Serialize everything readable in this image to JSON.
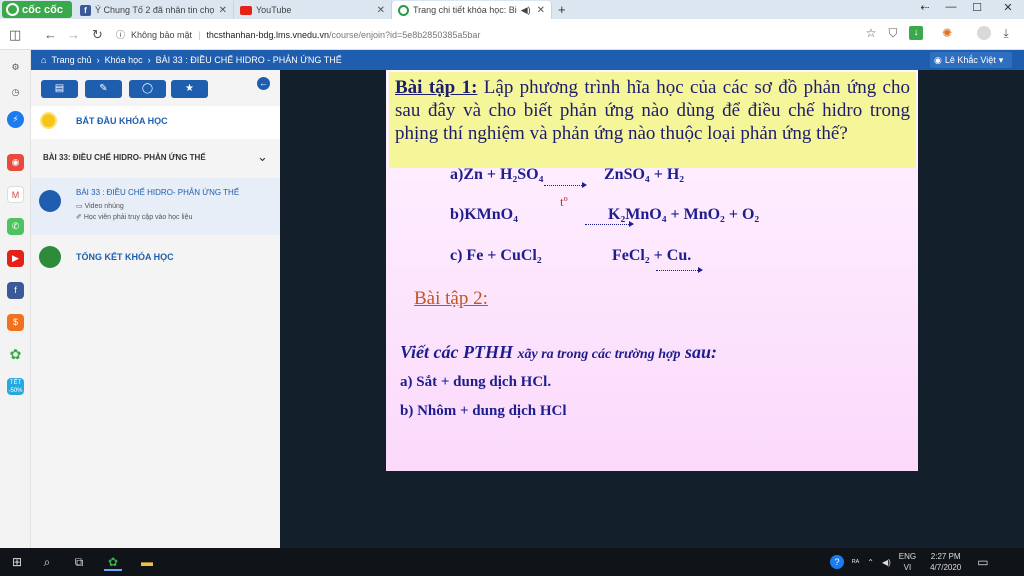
{
  "browser": {
    "brand": "cốc cốc",
    "tabs": [
      {
        "title": "Ý Chung Tố 2 đã nhân tin chọ",
        "icon": "facebook-icon"
      },
      {
        "title": "YouTube",
        "icon": "youtube-icon"
      },
      {
        "title": "Trang chi tiết khóa học: Bi",
        "icon": "coccoc-icon",
        "active": true
      }
    ],
    "new_tab": "+",
    "window_buttons": [
      "⇠",
      "—",
      "☐",
      "✕"
    ],
    "security_label": "Không bảo mật",
    "url_host": "thcsthanhan-bdg.lms.vnedu.vn",
    "url_path": "/course/enjoin?id=5e8b2850385a5bar"
  },
  "site_nav": {
    "home": "Trang chủ",
    "course": "Khóa học",
    "lesson": "BÀI 33 : ĐIỀU CHẾ HIDRO - PHẢN ỨNG THẾ",
    "user": "Lê Khắc Việt"
  },
  "course_panel": {
    "tools": [
      "book-icon",
      "pencil-icon",
      "chat-icon",
      "star-icon"
    ],
    "start_label": "BẮT ĐẦU KHÓA HỌC",
    "section_label": "BÀI 33: ĐIỀU CHẾ HIDRO- PHẢN ỨNG THẾ",
    "lesson_title": "BÀI 33 : ĐIỀU CHẾ HIDRO- PHẢN ỨNG THẾ",
    "lesson_type": "Video nhúng",
    "lesson_note": "Học viên phải truy cập vào học liệu",
    "summary_label": "TỔNG KẾT KHÓA HỌC",
    "colors": {
      "start_dot": "#f5c518",
      "lesson_dot": "#1f5eaf",
      "summary_dot": "#2e8b3a"
    }
  },
  "slide": {
    "ex1_label": "Bài tập 1:",
    "ex1_text": "Lập phương trình hĩa học của các sơ đồ phản ứng cho sau đây và cho biết phản ứng nào dùng để điều chế hidro trong phịng thí nghiệm và phản ứng nào thuộc loại phản ứng thế?",
    "eq_a_left": "a)Zn + H₂SO₄",
    "eq_a_right": "ZnSO₄ + H₂",
    "eq_b_left": "b)KMnO₄",
    "eq_b_cond": "tº",
    "eq_b_right": "K₂MnO₄ + MnO₂ + O₂",
    "eq_c_left": "c) Fe + CuCl₂",
    "eq_c_right": "FeCl₂ + Cu.",
    "ex2_label": "Bài tập 2:",
    "ex2_lead": "Viết các PTHH",
    "ex2_mid": "xãy ra trong các trường hợp",
    "ex2_tail": "sau:",
    "ex2_a": "a) Sắt + dung dịch HCl.",
    "ex2_b": "b) Nhôm + dung dịch HCl"
  },
  "taskbar": {
    "lang_top": "ENG",
    "lang_bottom": "VI",
    "time": "2:27 PM",
    "date": "4/7/2020",
    "sale_badge": "TẾT -50%"
  }
}
